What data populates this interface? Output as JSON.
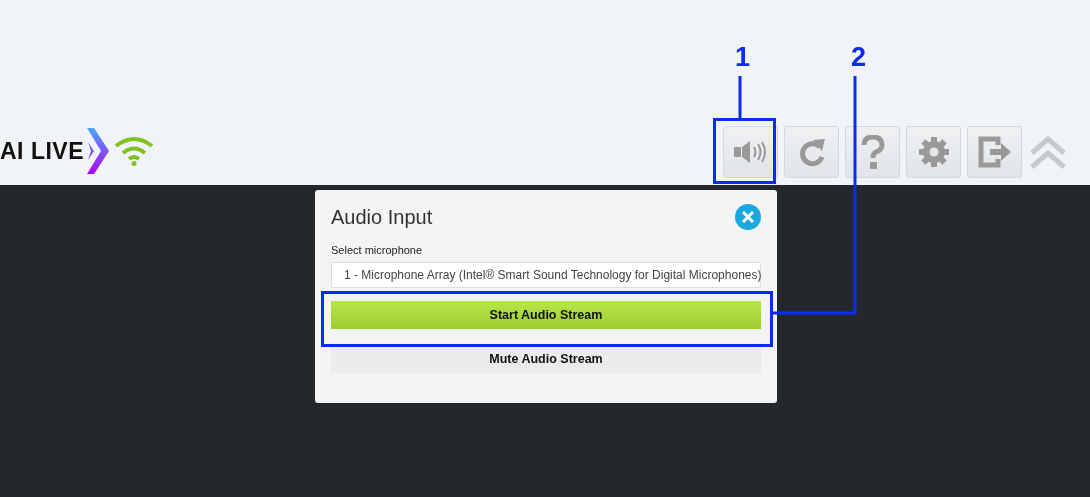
{
  "header": {
    "logo_text": "AI LIVE",
    "toolbar": [
      {
        "kind": "sound"
      },
      {
        "kind": "refresh"
      },
      {
        "kind": "help"
      },
      {
        "kind": "settings"
      },
      {
        "kind": "logout"
      },
      {
        "kind": "collapse"
      }
    ]
  },
  "dialog": {
    "title": "Audio Input",
    "field_label": "Select microphone",
    "microphone": "1 - Microphone Array (Intel® Smart Sound Technology for Digital Microphones)",
    "buttons": [
      {
        "label": "Start Audio Stream",
        "kind": "primary"
      },
      {
        "label": "Mute Audio Stream",
        "kind": "secondary"
      }
    ]
  },
  "callouts": [
    {
      "label": "1"
    },
    {
      "label": "2"
    }
  ]
}
